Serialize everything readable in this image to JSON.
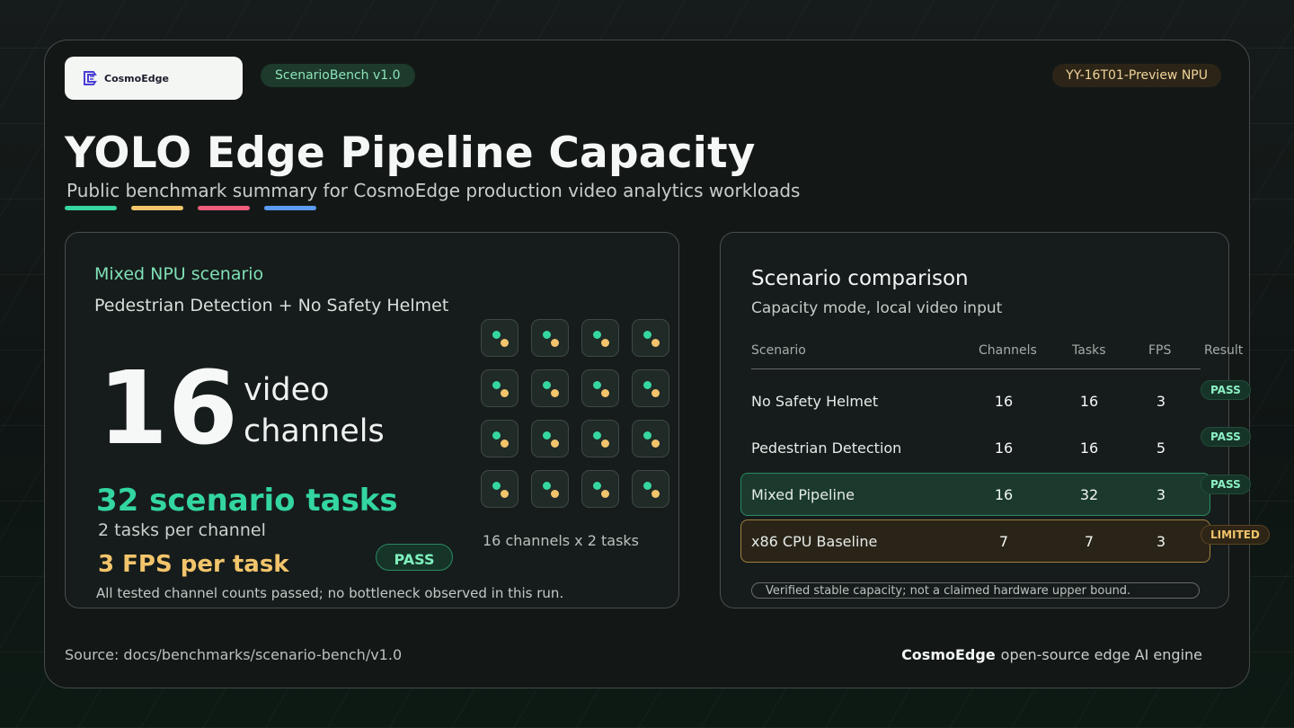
{
  "header": {
    "brand": "CosmoEdge",
    "bench_pill": "ScenarioBench v1.0",
    "device_pill": "YY-16T01-Preview NPU"
  },
  "hero": {
    "title": "YOLO Edge Pipeline Capacity",
    "subtitle": "Public benchmark summary for CosmoEdge production video analytics workloads",
    "accent_colors": [
      "#36d6a0",
      "#f2c46b",
      "#ef5d7a",
      "#5b9cf0"
    ]
  },
  "left_card": {
    "scenario_label": "Mixed NPU scenario",
    "scenario_desc": "Pedestrian Detection + No Safety Helmet",
    "channels": "16",
    "channels_unit": "video channels",
    "tasks": "32 scenario tasks",
    "tasks_per_channel": "2 tasks per channel",
    "fps": "3 FPS per task",
    "status": "PASS",
    "note": "All tested channel counts passed; no bottleneck observed in this run.",
    "grid_caption": "16 channels x 2 tasks",
    "grid_count": 16
  },
  "right_card": {
    "title": "Scenario comparison",
    "subtitle": "Capacity mode, local video input",
    "columns": [
      "Scenario",
      "Channels",
      "Tasks",
      "FPS",
      "Result"
    ],
    "rows": [
      {
        "scenario": "No Safety Helmet",
        "channels": "16",
        "tasks": "16",
        "fps": "3",
        "result": "PASS",
        "highlight": ""
      },
      {
        "scenario": "Pedestrian Detection",
        "channels": "16",
        "tasks": "16",
        "fps": "5",
        "result": "PASS",
        "highlight": ""
      },
      {
        "scenario": "Mixed Pipeline",
        "channels": "16",
        "tasks": "32",
        "fps": "3",
        "result": "PASS",
        "highlight": "green"
      },
      {
        "scenario": "x86 CPU Baseline",
        "channels": "7",
        "tasks": "7",
        "fps": "3",
        "result": "LIMITED",
        "highlight": "amber"
      }
    ],
    "note": "Verified stable capacity; not a claimed hardware upper bound."
  },
  "footer": {
    "source": "Source: docs/benchmarks/scenario-bench/v1.0",
    "brand": "CosmoEdge",
    "tagline": "open-source edge AI engine"
  }
}
